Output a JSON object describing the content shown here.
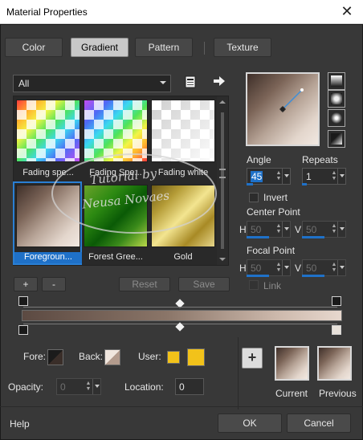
{
  "window": {
    "title": "Material Properties",
    "close_glyph": "✕"
  },
  "tabs": [
    {
      "label": "Color"
    },
    {
      "label": "Gradient"
    },
    {
      "label": "Pattern"
    },
    {
      "label": "Texture"
    }
  ],
  "active_tab": "Gradient",
  "category_dropdown": {
    "value": "All"
  },
  "gallery": {
    "items": [
      {
        "caption": "Fading spe..."
      },
      {
        "caption": "Fading Spe..."
      },
      {
        "caption": "Fading white"
      },
      {
        "caption": "Foregroun...",
        "selected": true
      },
      {
        "caption": "Forest Gree..."
      },
      {
        "caption": "Gold"
      }
    ]
  },
  "gallery_buttons": {
    "add": "+",
    "remove": "-",
    "reset": "Reset",
    "save": "Save"
  },
  "style": {
    "angle_label": "Angle",
    "angle_value": "45",
    "repeats_label": "Repeats",
    "repeats_value": "1",
    "invert_label": "Invert",
    "center_point_label": "Center Point",
    "h_label": "H",
    "v_label": "V",
    "center_h": "50",
    "center_v": "50",
    "focal_point_label": "Focal Point",
    "focal_h": "50",
    "focal_v": "50",
    "link_label": "Link"
  },
  "stops": {
    "fore_label": "Fore:",
    "back_label": "Back:",
    "user_label": "User:",
    "user_color": "#f2c21a",
    "opacity_label": "Opacity:",
    "opacity_value": "0",
    "location_label": "Location:",
    "location_value": "0"
  },
  "compare": {
    "add_glyph": "+",
    "current_label": "Current",
    "previous_label": "Previous"
  },
  "footer": {
    "help": "Help",
    "ok": "OK",
    "cancel": "Cancel"
  },
  "watermark": {
    "line1": "Tutorial by",
    "line2": "Neusa Novaes"
  },
  "colors": {
    "accent": "#1f71c8",
    "dialog_bg": "#383838"
  },
  "icons": [
    "close-icon",
    "page-icon",
    "arrow-right-icon",
    "linear-gradient-icon",
    "rectangular-gradient-icon",
    "sunburst-gradient-icon",
    "radial-gradient-icon",
    "plus-icon"
  ]
}
